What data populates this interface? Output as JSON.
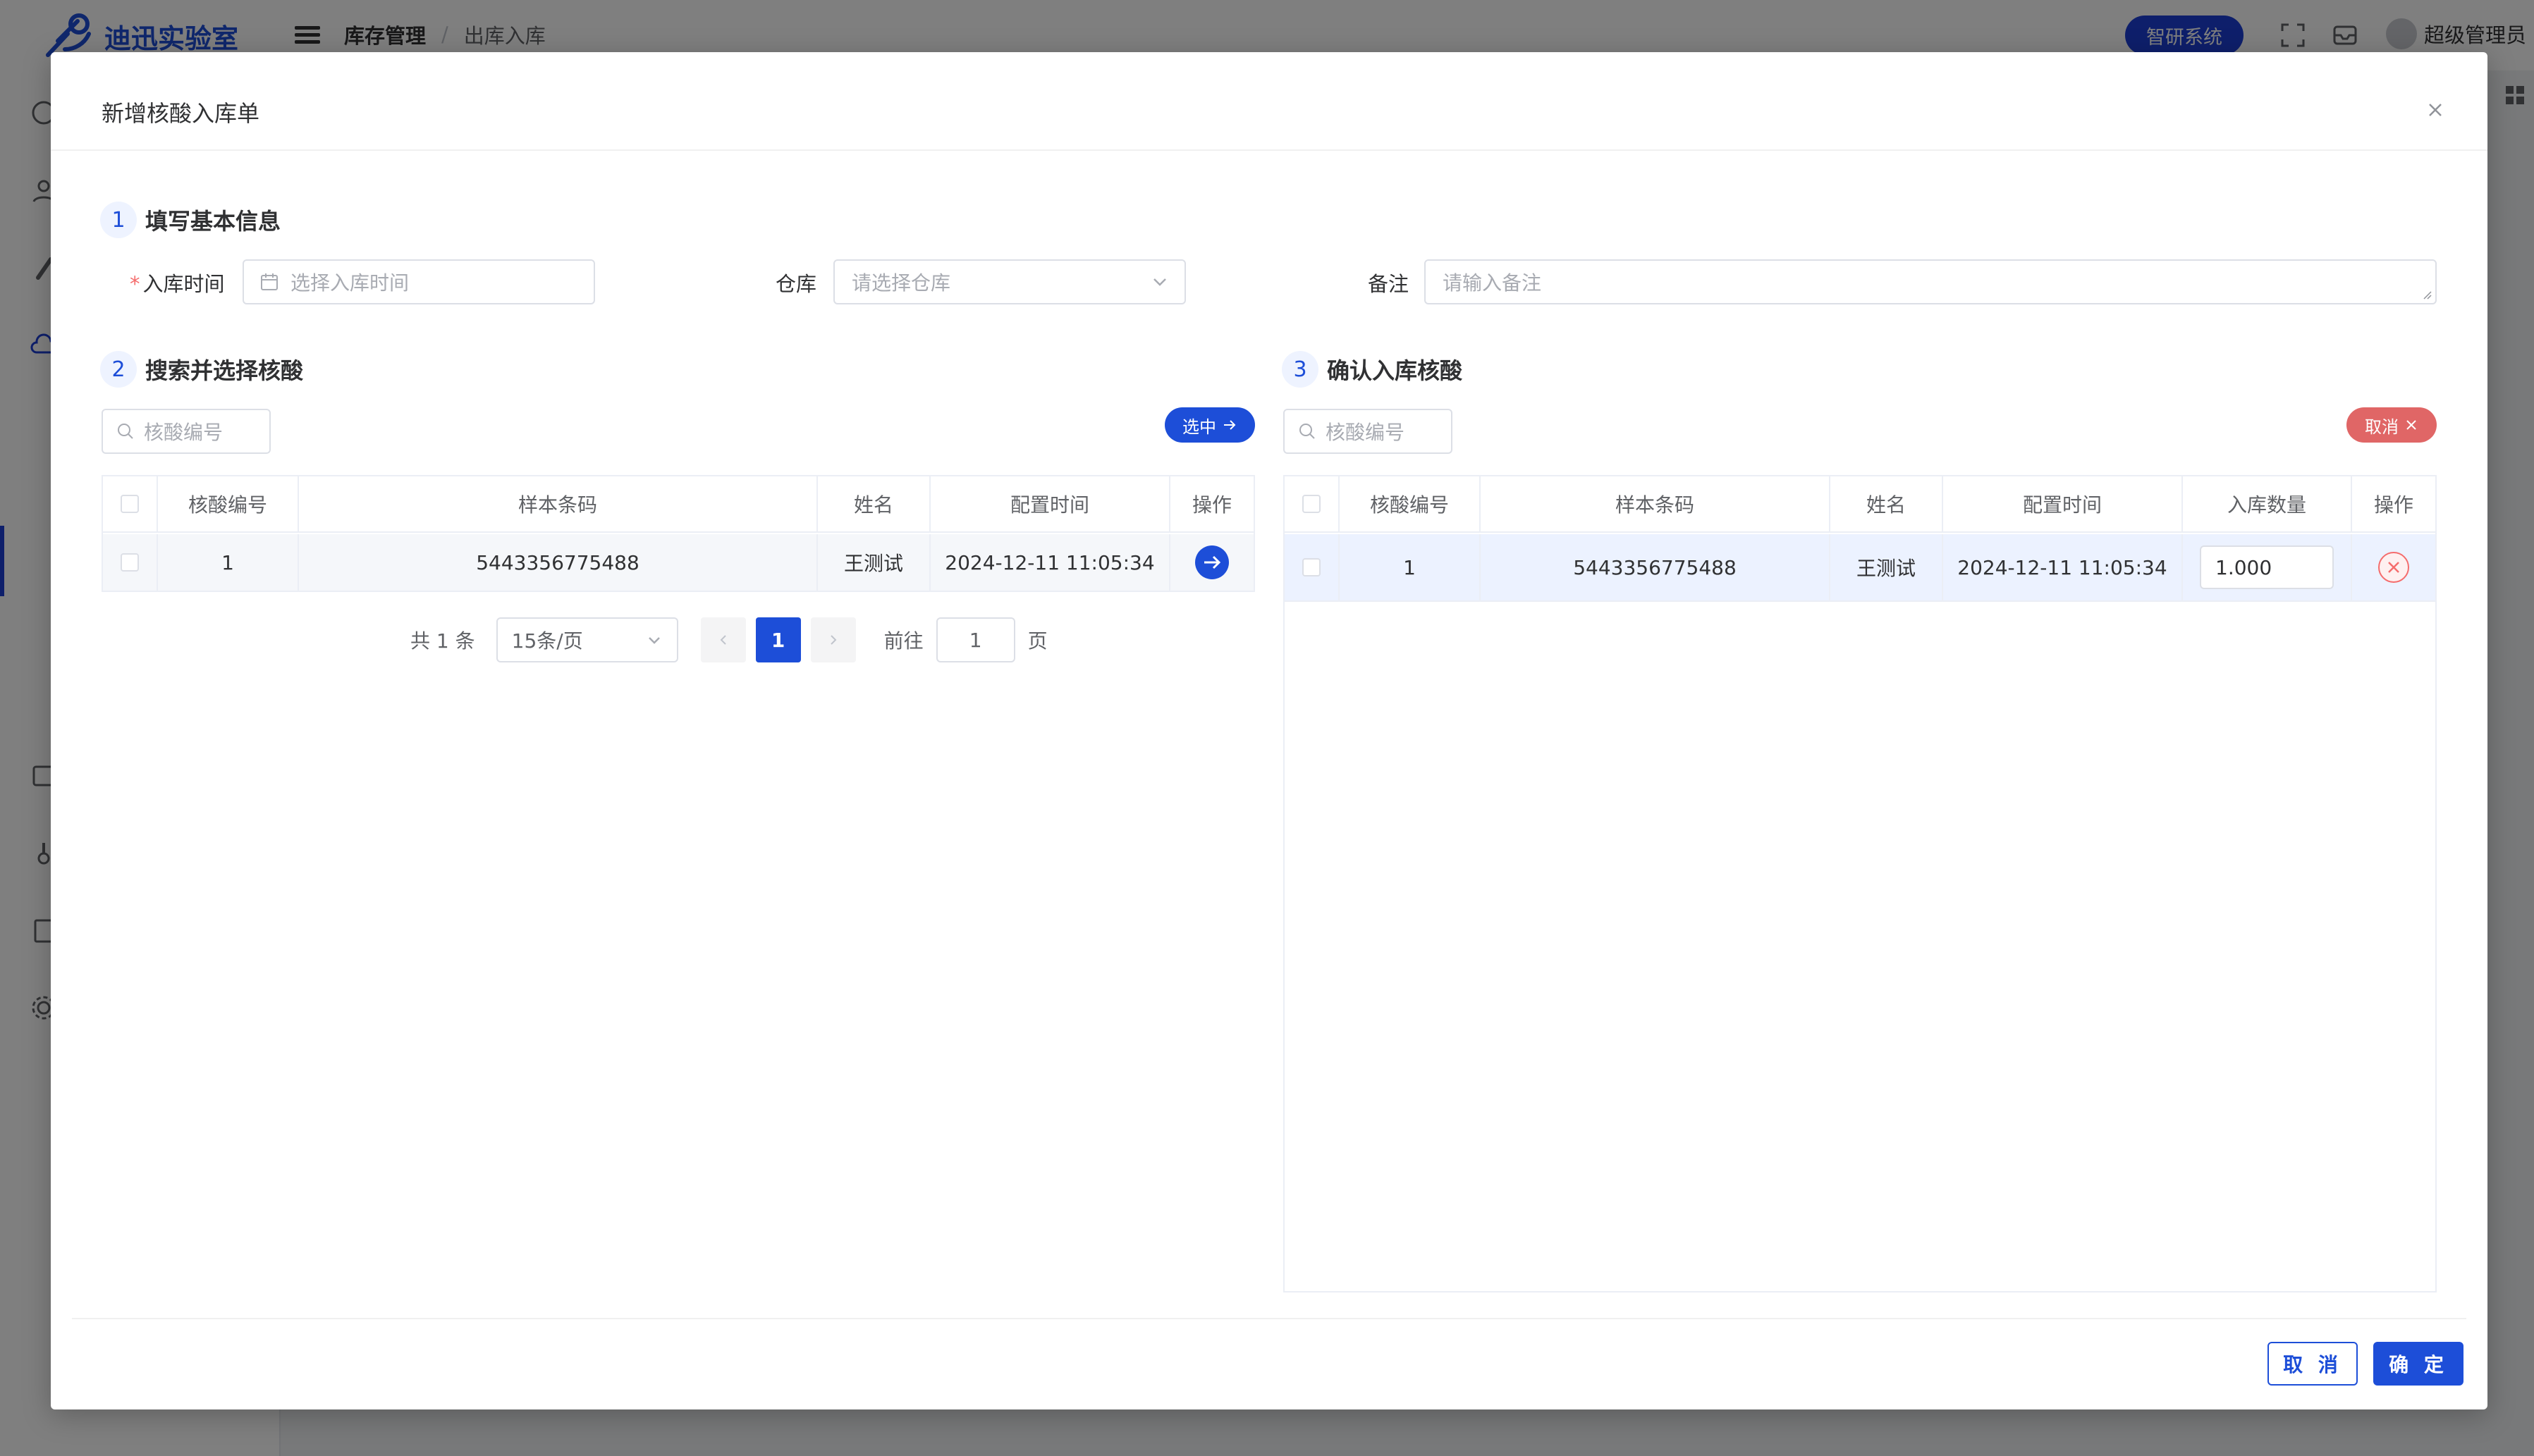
{
  "app": {
    "logo_text": "迪迅实验室",
    "breadcrumb": [
      "库存管理",
      "出库入库"
    ],
    "breadcrumb_sep": "/",
    "system_button": "智研系统",
    "user_name": "超级管理员"
  },
  "dialog": {
    "title": "新增核酸入库单",
    "step1": {
      "num": "1",
      "title": "填写基本信息"
    },
    "step2": {
      "num": "2",
      "title": "搜索并选择核酸"
    },
    "step3": {
      "num": "3",
      "title": "确认入库核酸"
    },
    "form": {
      "time_label": "入库时间",
      "time_placeholder": "选择入库时间",
      "required_mark": "*",
      "warehouse_label": "仓库",
      "warehouse_placeholder": "请选择仓库",
      "remark_label": "备注",
      "remark_placeholder": "请输入备注"
    },
    "left": {
      "search_placeholder": "核酸编号",
      "select_button": "选中",
      "columns": [
        "核酸编号",
        "样本条码",
        "姓名",
        "配置时间",
        "操作"
      ],
      "rows": [
        {
          "id": "1",
          "barcode": "5443356775488",
          "name": "王测试",
          "time": "2024-12-11 11:05:34"
        }
      ],
      "pager": {
        "total": "共 1 条",
        "page_size": "15条/页",
        "current": "1",
        "goto_label": "前往",
        "goto_value": "1",
        "page_suffix": "页"
      }
    },
    "right": {
      "search_placeholder": "核酸编号",
      "cancel_button": "取消",
      "columns": [
        "核酸编号",
        "样本条码",
        "姓名",
        "配置时间",
        "入库数量",
        "操作"
      ],
      "rows": [
        {
          "id": "1",
          "barcode": "5443356775488",
          "name": "王测试",
          "time": "2024-12-11 11:05:34",
          "qty": "1.000"
        }
      ]
    },
    "footer": {
      "cancel": "取 消",
      "confirm": "确 定"
    }
  },
  "colors": {
    "primary": "#1d4ed8",
    "danger": "#e06666",
    "mask": "rgba(0,0,0,0.5)"
  }
}
